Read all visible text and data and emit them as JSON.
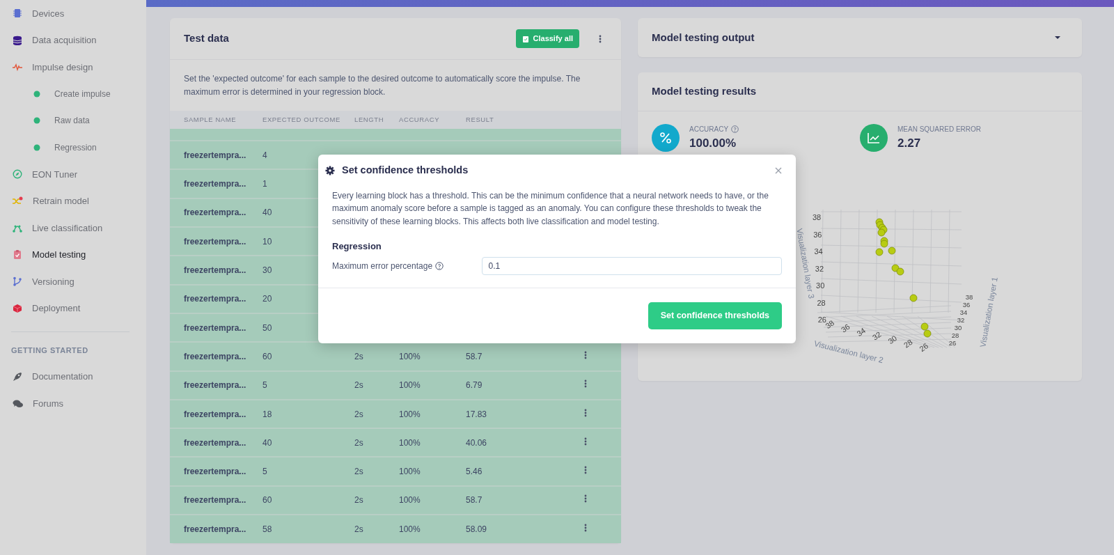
{
  "sidebar": {
    "items": [
      {
        "label": "Devices",
        "selected": false
      },
      {
        "label": "Data acquisition",
        "selected": false
      },
      {
        "label": "Impulse design",
        "selected": false,
        "children": [
          {
            "label": "Create impulse"
          },
          {
            "label": "Raw data"
          },
          {
            "label": "Regression"
          }
        ]
      },
      {
        "label": "EON Tuner",
        "selected": false
      },
      {
        "label": "Retrain model",
        "selected": false
      },
      {
        "label": "Live classification",
        "selected": false
      },
      {
        "label": "Model testing",
        "selected": true
      },
      {
        "label": "Versioning",
        "selected": false
      },
      {
        "label": "Deployment",
        "selected": false
      }
    ],
    "section_title": "GETTING STARTED",
    "links": [
      {
        "label": "Documentation"
      },
      {
        "label": "Forums"
      }
    ]
  },
  "test_data": {
    "title": "Test data",
    "classify_button": "Classify all",
    "description": "Set the 'expected outcome' for each sample to the desired outcome to automatically score the impulse. The maximum error is determined in your regression block.",
    "columns": [
      "SAMPLE NAME",
      "EXPECTED OUTCOME",
      "LENGTH",
      "ACCURACY",
      "RESULT"
    ],
    "rows": [
      {
        "name": "freezertempra...",
        "expected": "4"
      },
      {
        "name": "freezertempra...",
        "expected": "1"
      },
      {
        "name": "freezertempra...",
        "expected": "40"
      },
      {
        "name": "freezertempra...",
        "expected": "10"
      },
      {
        "name": "freezertempra...",
        "expected": "30"
      },
      {
        "name": "freezertempra...",
        "expected": "20"
      },
      {
        "name": "freezertempra...",
        "expected": "50"
      },
      {
        "name": "freezertempra...",
        "expected": "60",
        "length": "2s",
        "accuracy": "100%",
        "result": "58.7"
      },
      {
        "name": "freezertempra...",
        "expected": "5",
        "length": "2s",
        "accuracy": "100%",
        "result": "6.79"
      },
      {
        "name": "freezertempra...",
        "expected": "18",
        "length": "2s",
        "accuracy": "100%",
        "result": "17.83"
      },
      {
        "name": "freezertempra...",
        "expected": "40",
        "length": "2s",
        "accuracy": "100%",
        "result": "40.06"
      },
      {
        "name": "freezertempra...",
        "expected": "5",
        "length": "2s",
        "accuracy": "100%",
        "result": "5.46"
      },
      {
        "name": "freezertempra...",
        "expected": "60",
        "length": "2s",
        "accuracy": "100%",
        "result": "58.7"
      },
      {
        "name": "freezertempra...",
        "expected": "58",
        "length": "2s",
        "accuracy": "100%",
        "result": "58.09"
      }
    ]
  },
  "output_panel": {
    "title": "Model testing output",
    "expanded": false
  },
  "results": {
    "title": "Model testing results",
    "stats": [
      {
        "label": "ACCURACY",
        "value": "100.00%",
        "help": true
      },
      {
        "label": "MEAN SQUARED ERROR",
        "value": "2.27",
        "help": false
      }
    ],
    "plot": {
      "axis_titles": [
        "Visualization layer 3",
        "Visualization layer 2",
        "Visualization layer 1"
      ],
      "z_ticks": [
        "38",
        "36",
        "34",
        "32",
        "30",
        "28",
        "26"
      ],
      "x_ticks": [
        "38",
        "36",
        "34",
        "32",
        "30",
        "28",
        "26"
      ],
      "y_ticks": [
        "38",
        "36",
        "34",
        "32",
        "30",
        "28",
        "26"
      ]
    }
  },
  "modal": {
    "title": "Set confidence thresholds",
    "text": "Every learning block has a threshold. This can be the minimum confidence that a neural network needs to have, or the maximum anomaly score before a sample is tagged as an anomaly. You can configure these thresholds to tweak the sensitivity of these learning blocks. This affects both live classification and model testing.",
    "section": "Regression",
    "field_label": "Maximum error percentage",
    "field_value": "0.1",
    "button": "Set confidence thresholds"
  }
}
